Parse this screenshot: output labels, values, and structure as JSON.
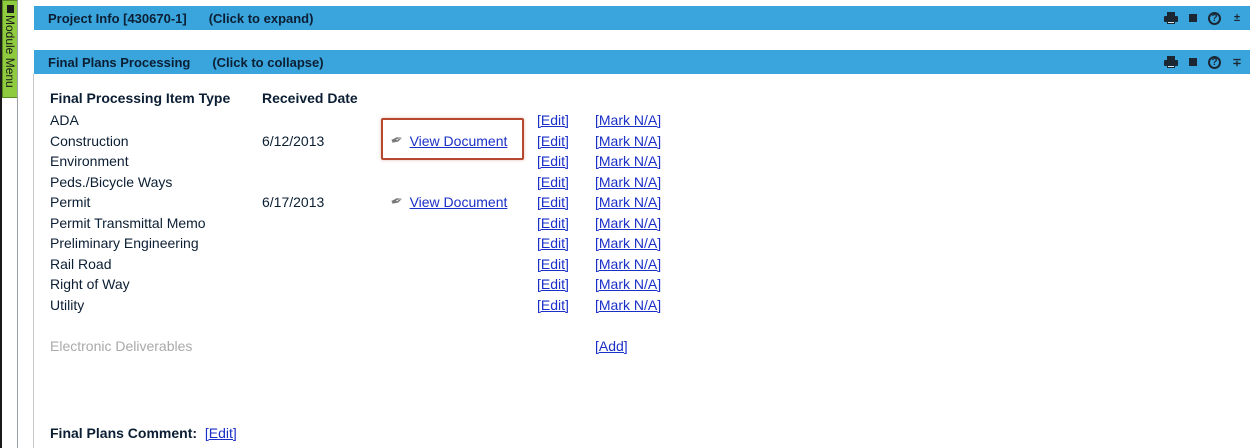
{
  "module_menu": {
    "label": "Module Menu"
  },
  "sections": [
    {
      "title": "Project Info [430670-1]",
      "hint": "(Click to expand)",
      "toggle": "±"
    },
    {
      "title": "Final Plans Processing",
      "hint": "(Click to collapse)",
      "toggle": "∓"
    }
  ],
  "table": {
    "headers": {
      "type": "Final Processing Item Type",
      "date": "Received Date"
    },
    "rows": [
      {
        "type": "ADA",
        "date": "",
        "doc": "",
        "edit": "[Edit]",
        "na": "[Mark N/A]"
      },
      {
        "type": "Construction",
        "date": "6/12/2013",
        "doc": "View Document",
        "edit": "[Edit]",
        "na": "[Mark N/A]"
      },
      {
        "type": "Environment",
        "date": "",
        "doc": "",
        "edit": "[Edit]",
        "na": "[Mark N/A]"
      },
      {
        "type": "Peds./Bicycle Ways",
        "date": "",
        "doc": "",
        "edit": "[Edit]",
        "na": "[Mark N/A]"
      },
      {
        "type": "Permit",
        "date": "6/17/2013",
        "doc": "View Document",
        "edit": "[Edit]",
        "na": "[Mark N/A]"
      },
      {
        "type": "Permit Transmittal Memo",
        "date": "",
        "doc": "",
        "edit": "[Edit]",
        "na": "[Mark N/A]"
      },
      {
        "type": "Preliminary Engineering",
        "date": "",
        "doc": "",
        "edit": "[Edit]",
        "na": "[Mark N/A]"
      },
      {
        "type": "Rail Road",
        "date": "",
        "doc": "",
        "edit": "[Edit]",
        "na": "[Mark N/A]"
      },
      {
        "type": "Right of Way",
        "date": "",
        "doc": "",
        "edit": "[Edit]",
        "na": "[Mark N/A]"
      },
      {
        "type": "Utility",
        "date": "",
        "doc": "",
        "edit": "[Edit]",
        "na": "[Mark N/A]"
      }
    ]
  },
  "deliverables": {
    "label": "Electronic Deliverables",
    "add": "[Add]"
  },
  "comment": {
    "label": "Final Plans Comment:",
    "edit": "[Edit]"
  },
  "icons": {
    "paperclip": "paperclip-icon",
    "print": "print-icon",
    "help": "help-icon"
  },
  "colors": {
    "header_bar": "#3aa5dc",
    "link": "#1a2fc7",
    "highlight": "#b5482e",
    "module_menu": "#8fcb3f"
  }
}
